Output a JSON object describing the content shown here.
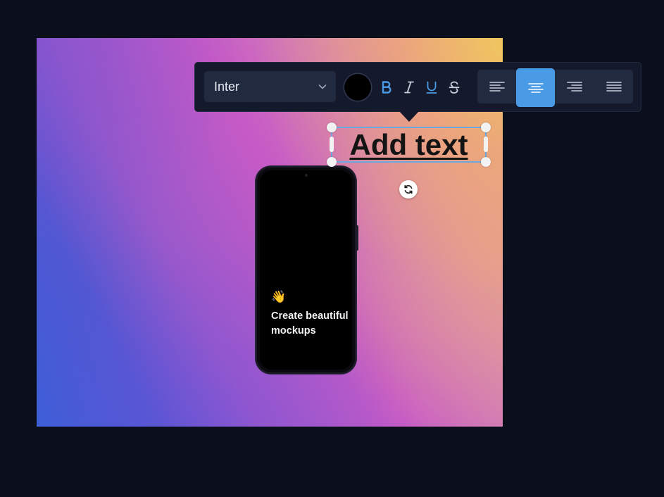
{
  "toolbar": {
    "font_family": "Inter",
    "text_color": "#000000",
    "format_buttons": [
      "bold-icon",
      "italic-icon",
      "underline-icon",
      "strikethrough-icon"
    ],
    "active_format": [
      "bold",
      "underline"
    ],
    "alignment_options": [
      "align-left",
      "align-center",
      "align-right",
      "align-justify"
    ],
    "selected_alignment": "align-center",
    "accent_color": "#4a9be6"
  },
  "canvas": {
    "text_element": "Add text",
    "phone": {
      "emoji": "👋",
      "caption": "Create beautiful mockups"
    }
  }
}
